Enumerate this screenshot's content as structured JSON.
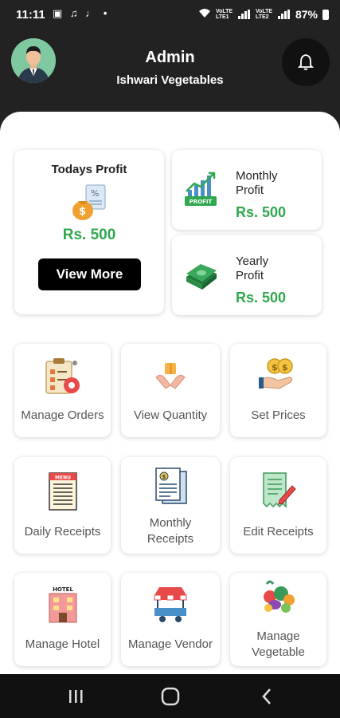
{
  "status_bar": {
    "time": "11:11",
    "volte1": "VoLTE LTE1",
    "volte2": "VoLTE LTE2",
    "battery": "87%"
  },
  "header": {
    "title": "Admin",
    "subtitle": "Ishwari Vegetables"
  },
  "today": {
    "title": "Todays Profit",
    "amount": "Rs. 500",
    "button": "View More"
  },
  "monthly": {
    "title_line1": "Monthly",
    "title_line2": "Profit",
    "amount": "Rs. 500",
    "icon_text": "PROFIT"
  },
  "yearly": {
    "title_line1": "Yearly",
    "title_line2": "Profit",
    "amount": "Rs. 500"
  },
  "tiles": {
    "manage_orders": "Manage Orders",
    "view_quantity": "View Quantity",
    "set_prices": "Set Prices",
    "daily_receipts": "Daily Receipts",
    "monthly_receipts_l1": "Monthly",
    "monthly_receipts_l2": "Receipts",
    "edit_receipts": "Edit Receipts",
    "manage_hotel": "Manage Hotel",
    "hotel_sign": "HOTEL",
    "manage_vendor": "Manage Vendor",
    "manage_vegetable_l1": "Manage",
    "manage_vegetable_l2": "Vegetable"
  },
  "colors": {
    "accent_green": "#2fa84f",
    "header_bg": "#222222",
    "button_bg": "#000000"
  }
}
